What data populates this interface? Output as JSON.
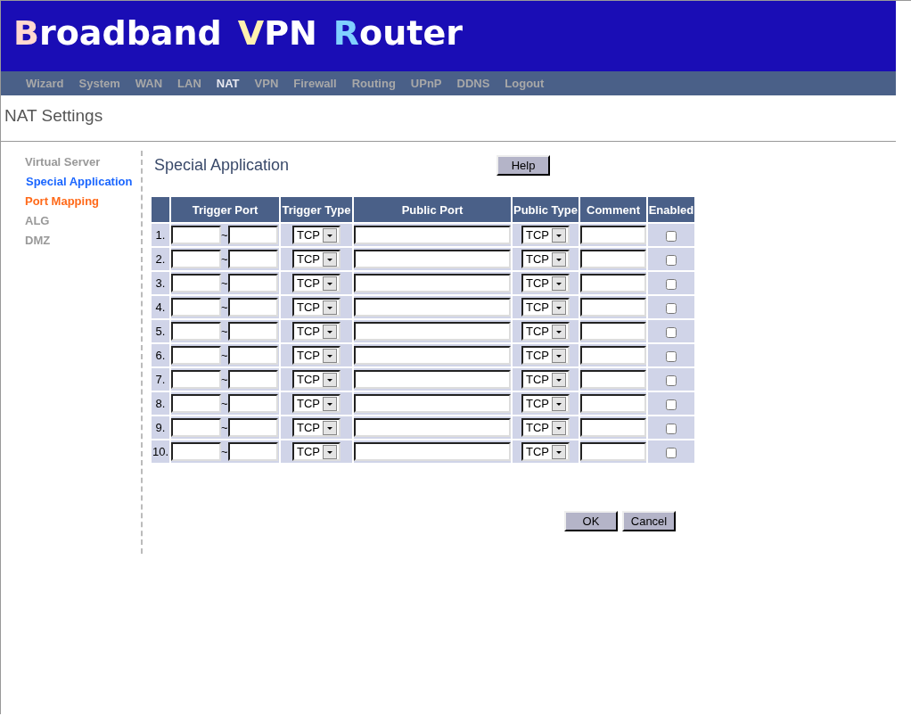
{
  "logo": [
    {
      "initial": "B",
      "rest": "roadband",
      "color": "#ffd8d0"
    },
    {
      "initial": "V",
      "rest": "PN",
      "color": "#fff0b0"
    },
    {
      "initial": "R",
      "rest": "outer",
      "color": "#80d0ff"
    }
  ],
  "nav": [
    {
      "label": "Wizard",
      "selected": false
    },
    {
      "label": "System",
      "selected": false
    },
    {
      "label": "WAN",
      "selected": false
    },
    {
      "label": "LAN",
      "selected": false
    },
    {
      "label": "NAT",
      "selected": true
    },
    {
      "label": "VPN",
      "selected": false
    },
    {
      "label": "Firewall",
      "selected": false
    },
    {
      "label": "Routing",
      "selected": false
    },
    {
      "label": "UPnP",
      "selected": false
    },
    {
      "label": "DDNS",
      "selected": false
    },
    {
      "label": "Logout",
      "selected": false
    }
  ],
  "page_title": "NAT Settings",
  "sidebar": {
    "items": [
      {
        "label": "Virtual Server",
        "selected": false,
        "color": "#999999"
      },
      {
        "label": "Special Application",
        "selected": true,
        "color": "#1a66ff"
      },
      {
        "label": "Port Mapping",
        "selected": false,
        "color": "#ff6a1a"
      },
      {
        "label": "ALG",
        "selected": false,
        "color": "#999999"
      },
      {
        "label": "DMZ",
        "selected": false,
        "color": "#999999"
      }
    ]
  },
  "section_title": "Special Application",
  "help_button": "Help",
  "table": {
    "columns": [
      "Trigger Port",
      "Trigger Type",
      "Public Port",
      "Public Type",
      "Comment",
      "Enabled"
    ],
    "rows": [
      {
        "number": "1.",
        "separator": "~",
        "trigger_type": "TCP",
        "public_type": "TCP",
        "enabled": false
      },
      {
        "number": "2.",
        "separator": "~",
        "trigger_type": "TCP",
        "public_type": "TCP",
        "enabled": false
      },
      {
        "number": "3.",
        "separator": "~",
        "trigger_type": "TCP",
        "public_type": "TCP",
        "enabled": false
      },
      {
        "number": "4.",
        "separator": "~",
        "trigger_type": "TCP",
        "public_type": "TCP",
        "enabled": false
      },
      {
        "number": "5.",
        "separator": "~",
        "trigger_type": "TCP",
        "public_type": "TCP",
        "enabled": false
      },
      {
        "number": "6.",
        "separator": "~",
        "trigger_type": "TCP",
        "public_type": "TCP",
        "enabled": false
      },
      {
        "number": "7.",
        "separator": "~",
        "trigger_type": "TCP",
        "public_type": "TCP",
        "enabled": false
      },
      {
        "number": "8.",
        "separator": "~",
        "trigger_type": "TCP",
        "public_type": "TCP",
        "enabled": false
      },
      {
        "number": "9.",
        "separator": "~",
        "trigger_type": "TCP",
        "public_type": "TCP",
        "enabled": false
      },
      {
        "number": "10.",
        "separator": "~",
        "trigger_type": "TCP",
        "public_type": "TCP",
        "enabled": false
      }
    ]
  },
  "buttons": [
    "OK",
    "Cancel"
  ]
}
